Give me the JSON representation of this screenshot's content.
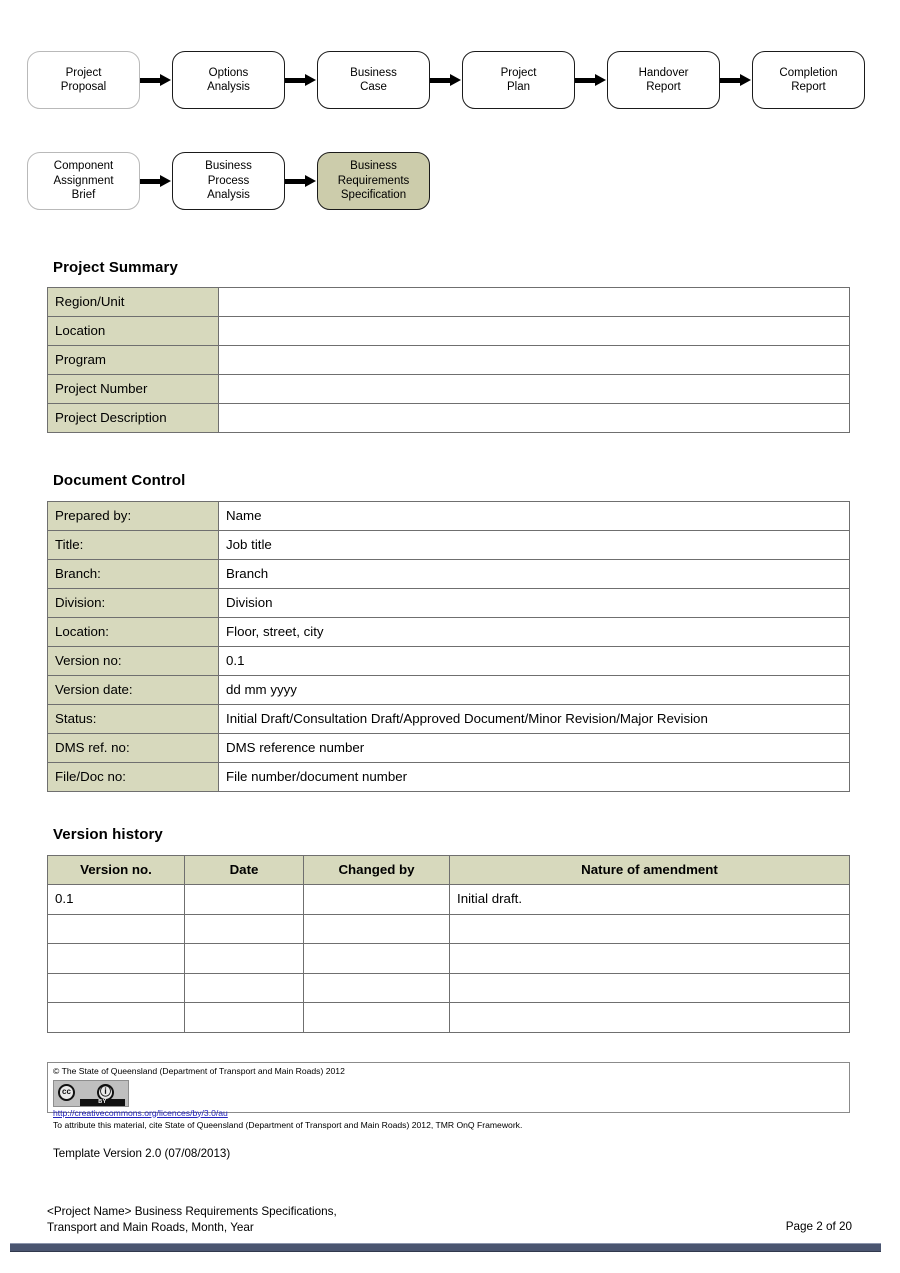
{
  "flowchart": {
    "row1": [
      {
        "label": "Project\nProposal",
        "style": "pale"
      },
      {
        "label": "Options\nAnalysis",
        "style": "normal"
      },
      {
        "label": "Business\nCase",
        "style": "normal"
      },
      {
        "label": "Project\nPlan",
        "style": "normal"
      },
      {
        "label": "Handover\nReport",
        "style": "normal"
      },
      {
        "label": "Completion\nReport",
        "style": "normal"
      }
    ],
    "row2": [
      {
        "label": "Component\nAssignment\nBrief",
        "style": "pale"
      },
      {
        "label": "Business\nProcess\nAnalysis",
        "style": "normal"
      },
      {
        "label": "Business\nRequirements\nSpecification",
        "style": "highlight"
      }
    ],
    "highlight_color": "#ccccab"
  },
  "project_summary": {
    "heading": "Project Summary",
    "rows": [
      {
        "label": "Region/Unit",
        "value": ""
      },
      {
        "label": "Location",
        "value": ""
      },
      {
        "label": "Program",
        "value": ""
      },
      {
        "label": "Project Number",
        "value": ""
      },
      {
        "label": "Project Description",
        "value": ""
      }
    ]
  },
  "document_control": {
    "heading": "Document Control",
    "rows": [
      {
        "label": "Prepared by:",
        "value": "Name"
      },
      {
        "label": "Title:",
        "value": "Job title"
      },
      {
        "label": "Branch:",
        "value": "Branch"
      },
      {
        "label": "Division:",
        "value": "Division"
      },
      {
        "label": "Location:",
        "value": "Floor, street, city"
      },
      {
        "label": "Version no:",
        "value": "0.1"
      },
      {
        "label": "Version date:",
        "value": "dd mm yyyy"
      },
      {
        "label": "Status:",
        "value": "Initial Draft/Consultation Draft/Approved Document/Minor Revision/Major Revision"
      },
      {
        "label": "DMS ref. no:",
        "value": "DMS reference number"
      },
      {
        "label": "File/Doc no:",
        "value": "File number/document number"
      }
    ]
  },
  "version_history": {
    "heading": "Version history",
    "columns": [
      "Version no.",
      "Date",
      "Changed by",
      "Nature of amendment"
    ],
    "rows": [
      [
        "0.1",
        "",
        "",
        "Initial draft."
      ],
      [
        "",
        "",
        "",
        ""
      ],
      [
        "",
        "",
        "",
        ""
      ],
      [
        "",
        "",
        "",
        ""
      ],
      [
        "",
        "",
        "",
        ""
      ]
    ]
  },
  "copyright": {
    "statement": "© The State of Queensland (Department of Transport and Main Roads) 2012",
    "badge": {
      "cc_text": "cc",
      "by_text": "BY",
      "person_glyph": "ⓘ"
    },
    "link": "http://creativecommons.org/licences/by/3.0/au",
    "attribution": "To attribute this material, cite State of Queensland (Department of Transport and Main Roads) 2012, TMR OnQ Framework."
  },
  "template_version": "Template Version 2.0 (07/08/2013)",
  "footer": {
    "left": "<Project Name> Business Requirements Specifications,\nTransport and Main Roads, Month, Year",
    "right": "Page 2 of 20",
    "rule_color": "#4a5570"
  }
}
